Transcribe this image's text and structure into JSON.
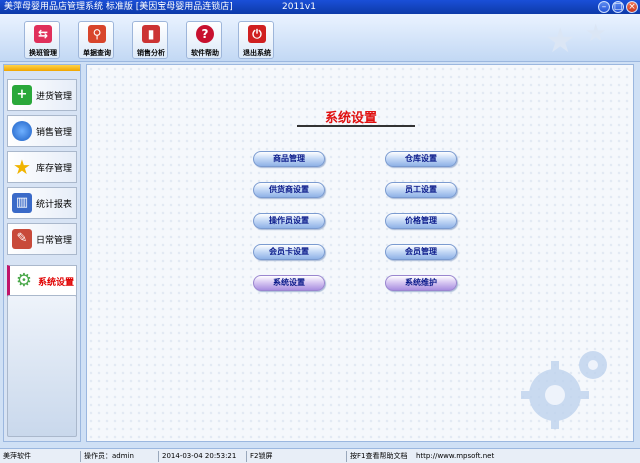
{
  "window": {
    "title": "美萍母婴用品店管理系统 标准版 [美因宝母婴用品连锁店]",
    "version": "2011v1"
  },
  "toolbar": {
    "items": [
      {
        "label": "换班管理",
        "icon": "shift-handover-icon",
        "color": "#e0305a"
      },
      {
        "label": "单据查询",
        "icon": "magnifier-icon",
        "color": "#d8452b"
      },
      {
        "label": "销售分析",
        "icon": "bar-chart-icon",
        "color": "#cc3333"
      },
      {
        "label": "软件帮助",
        "icon": "help-icon",
        "color": "#c8102e"
      },
      {
        "label": "退出系统",
        "icon": "power-icon",
        "color": "#d02020"
      }
    ]
  },
  "sidebar": {
    "items": [
      {
        "label": "进货管理",
        "icon": "plus-icon",
        "color": "#2aa83a"
      },
      {
        "label": "销售管理",
        "icon": "globe-icon",
        "color": "#3a7ad0"
      },
      {
        "label": "库存管理",
        "icon": "star-icon",
        "color": "#f0b400"
      },
      {
        "label": "统计报表",
        "icon": "report-icon",
        "color": "#3a6ac8"
      },
      {
        "label": "日常管理",
        "icon": "tools-icon",
        "color": "#c84a3a"
      },
      {
        "label": "系统设置",
        "icon": "gear-icon",
        "color": "#4aa84a"
      }
    ],
    "active_index": 5
  },
  "main": {
    "title": "系统设置",
    "buttons_left": [
      "商品管理",
      "供货商设置",
      "操作员设置",
      "会员卡设置",
      "系统设置"
    ],
    "buttons_right": [
      "仓库设置",
      "员工设置",
      "价格管理",
      "会员管理",
      "系统维护"
    ]
  },
  "status": {
    "app": "美萍软件",
    "operator": "操作员：admin",
    "datetime": "2014-03-04 20:53:21",
    "lock": "F2锁屏",
    "help": "按F1查看帮助文档",
    "url": "http://www.mpsoft.net"
  }
}
